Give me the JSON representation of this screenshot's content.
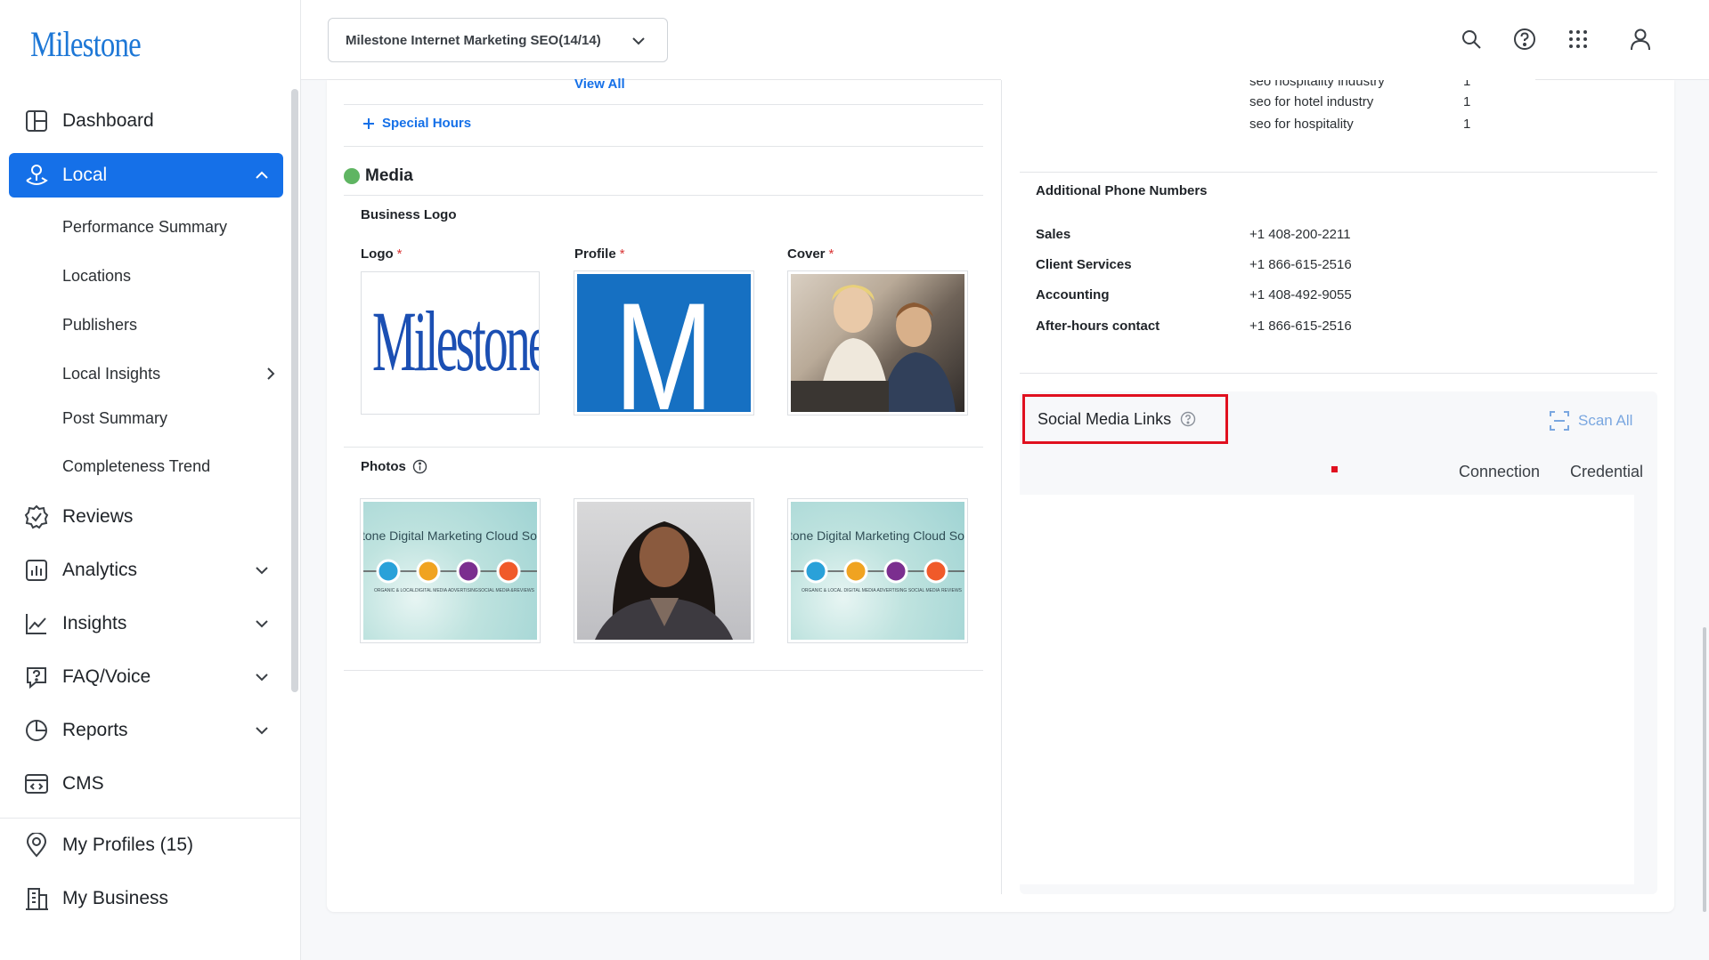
{
  "brand": {
    "logo_text": "Milestone",
    "accent": "#1570e8"
  },
  "sidebar": {
    "items": [
      {
        "label": "Dashboard",
        "icon": "dashboard-icon"
      },
      {
        "label": "Local",
        "icon": "local-pin-icon",
        "active": true,
        "expanded": true
      },
      {
        "label": "Reviews",
        "icon": "reviews-check-icon"
      },
      {
        "label": "Analytics",
        "icon": "analytics-bar-icon"
      },
      {
        "label": "Insights",
        "icon": "insights-line-icon"
      },
      {
        "label": "FAQ/Voice",
        "icon": "faq-icon"
      },
      {
        "label": "Reports",
        "icon": "reports-pie-icon"
      },
      {
        "label": "CMS",
        "icon": "cms-icon"
      },
      {
        "label": "My Profiles (15)",
        "icon": "profile-pin-icon"
      },
      {
        "label": "My Business",
        "icon": "business-building-icon"
      }
    ],
    "local_subitems": [
      "Performance Summary",
      "Locations",
      "Publishers",
      "Local Insights",
      "Post Summary",
      "Completeness Trend"
    ]
  },
  "header": {
    "account_select": "Milestone Internet Marketing SEO(14/14)",
    "icons": [
      "search-icon",
      "help-icon",
      "apps-grid-icon",
      "user-icon"
    ]
  },
  "left_col": {
    "view_all": "View All",
    "special_hours": "Special Hours",
    "media_title": "Media",
    "business_logo": "Business Logo",
    "logo_label": "Logo",
    "profile_label": "Profile",
    "cover_label": "Cover",
    "required_mark": "*",
    "photos_label": "Photos",
    "logo_image_text": "Milestone",
    "profile_image_text": "M",
    "photo_banner_text": "tone Digital Marketing Cloud Sol",
    "photo_banner_labels": [
      "ORGANIC & LOCAL",
      "DIGITAL MEDIA ADVERTISING",
      "SOCIAL MEDIA &",
      "REVIEWS"
    ],
    "photo_banner_labels_2": [
      "ORGANIC & LOCAL",
      "DIGITAL MEDIA ADVERTISING",
      "SOCIAL MEDIA",
      "REVIEWS"
    ]
  },
  "right_col": {
    "keywords": [
      {
        "term": "seo hospitality industry",
        "count": "1"
      },
      {
        "term": "seo for hotel industry",
        "count": "1"
      },
      {
        "term": "seo for hospitality",
        "count": "1"
      }
    ],
    "additional_phone_title": "Additional Phone Numbers",
    "phones": [
      {
        "label": "Sales",
        "value": "+1 408-200-2211"
      },
      {
        "label": "Client Services",
        "value": "+1 866-615-2516"
      },
      {
        "label": "Accounting",
        "value": "+1 408-492-9055"
      },
      {
        "label": "After-hours contact",
        "value": "+1 866-615-2516"
      }
    ],
    "social_title": "Social Media Links",
    "scan_all": "Scan All",
    "col_connection": "Connection",
    "col_credential": "Credential"
  }
}
